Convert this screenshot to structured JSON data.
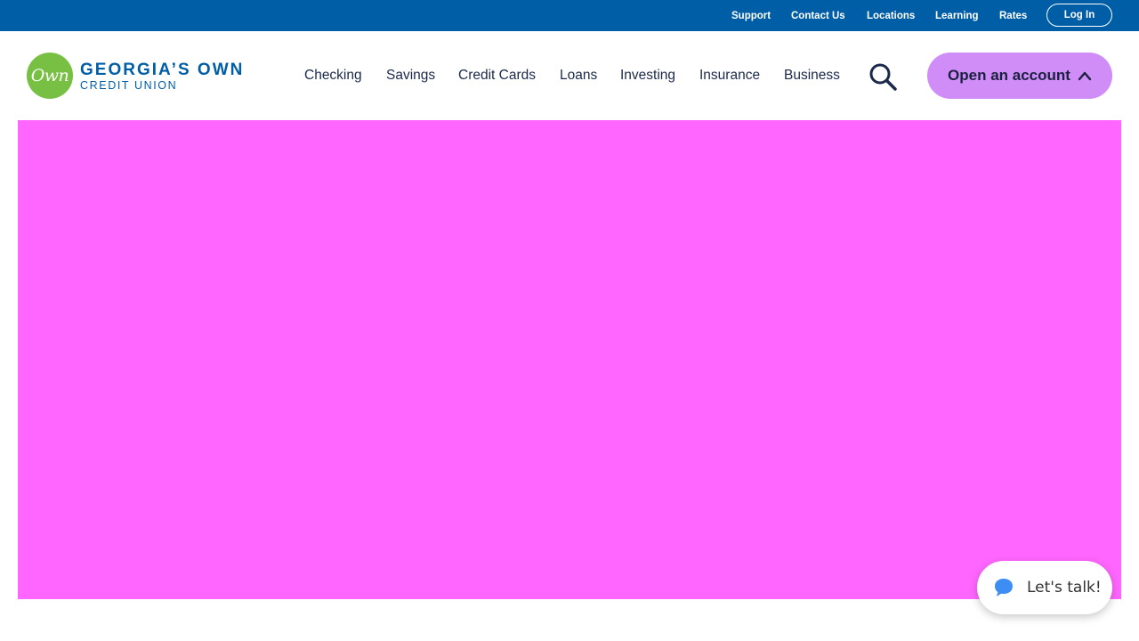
{
  "utility_nav": {
    "links": [
      "Support",
      "Contact Us",
      "Locations",
      "Learning",
      "Rates"
    ],
    "login_label": "Log In"
  },
  "logo": {
    "mark_text": "Own",
    "line1": "GEORGIA’S OWN",
    "line2": "CREDIT UNION"
  },
  "main_nav": {
    "items": [
      "Checking",
      "Savings",
      "Credit Cards",
      "Loans",
      "Investing",
      "Insurance",
      "Business"
    ],
    "search_icon": "search-icon",
    "open_account_label": "Open an account",
    "open_account_icon": "chevron-up-icon"
  },
  "hero": {
    "background_color": "#ff66ff"
  },
  "chat": {
    "label": "Let's talk!",
    "icon": "chat-bubble-icon"
  },
  "colors": {
    "utility_bar": "#005ea6",
    "brand_blue": "#005ea6",
    "brand_green": "#78c044",
    "nav_text": "#1b2a4a",
    "cta_background": "#d08cf7",
    "chat_icon": "#3d8df5"
  }
}
